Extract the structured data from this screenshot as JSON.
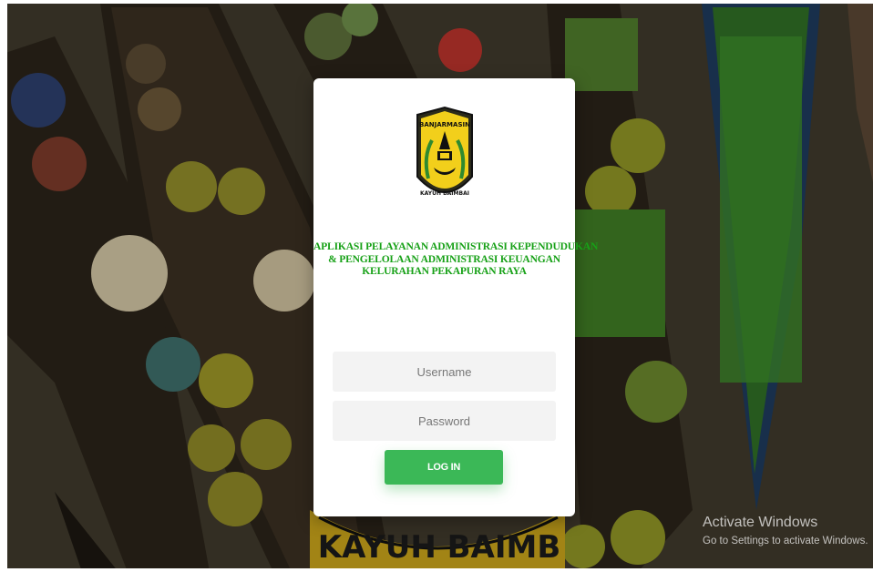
{
  "app": {
    "title_lines": [
      "APLIKASI PELAYANAN ADMINISTRASI KEPENDUDUKAN",
      "& PENGELOLAAN ADMINISTRASI KEUANGAN",
      "KELURAHAN PEKAPURAN RAYA"
    ],
    "logo_name": "emblem-banjarmasin",
    "logo_text_top": "BANJARMASIN",
    "logo_text_bottom": "KAYUH BAIMBAI"
  },
  "background": {
    "watermark_text": "KAYUH BAIMB"
  },
  "login": {
    "username_placeholder": "Username",
    "password_placeholder": "Password",
    "button_label": "LOG IN"
  },
  "system": {
    "activate_title": "Activate Windows",
    "activate_subtitle": "Go to Settings to activate Windows."
  },
  "colors": {
    "title_green": "#17a117",
    "button_green": "#3bb857",
    "field_bg": "#f3f3f3"
  }
}
